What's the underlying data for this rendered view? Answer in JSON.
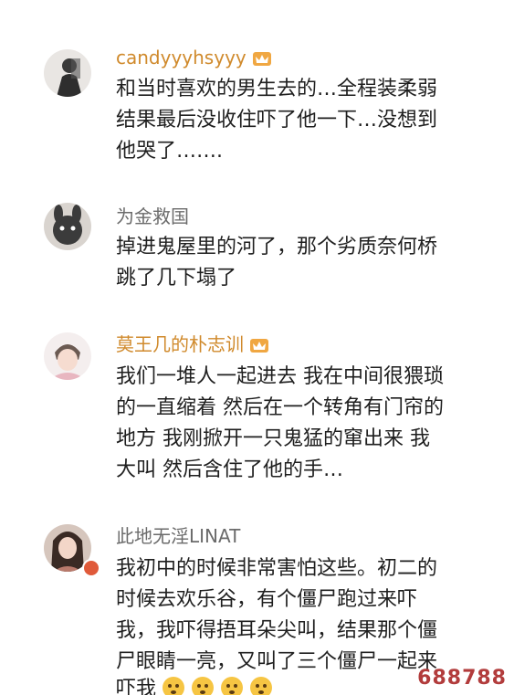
{
  "comments": [
    {
      "username": "candyyyhsyyy",
      "lines": [
        "和当时喜欢的男生去的…全程装柔弱",
        "结果最后没收住吓了他一下…没想到",
        "他哭了……."
      ]
    },
    {
      "username": "为金救国",
      "lines": [
        "掉进鬼屋里的河了，那个劣质奈何桥",
        "跳了几下塌了"
      ]
    },
    {
      "username": "莫王几的朴志训",
      "lines": [
        "我们一堆人一起进去 我在中间很猥琐",
        "的一直缩着 然后在一个转角有门帘的",
        "地方 我刚掀开一只鬼猛的窜出来 我",
        "大叫 然后含住了他的手…"
      ]
    },
    {
      "username": "此地无淫LINAT",
      "lines": [
        "我初中的时候非常害怕这些。初二的",
        "时候去欢乐谷，有个僵尸跑过来吓",
        "我，我吓得捂耳朵尖叫，结果那个僵",
        "尸眼睛一亮，又叫了三个僵尸一起来",
        "吓我"
      ]
    }
  ],
  "watermark": "688788",
  "colors": {
    "gold_username": "#d08a2c",
    "gray_username": "#6b6b6b",
    "body_text": "#1f1f1f",
    "watermark": "#b23c3c"
  },
  "icons": [
    "crown-badge-icon",
    "emoji-face-icon"
  ]
}
